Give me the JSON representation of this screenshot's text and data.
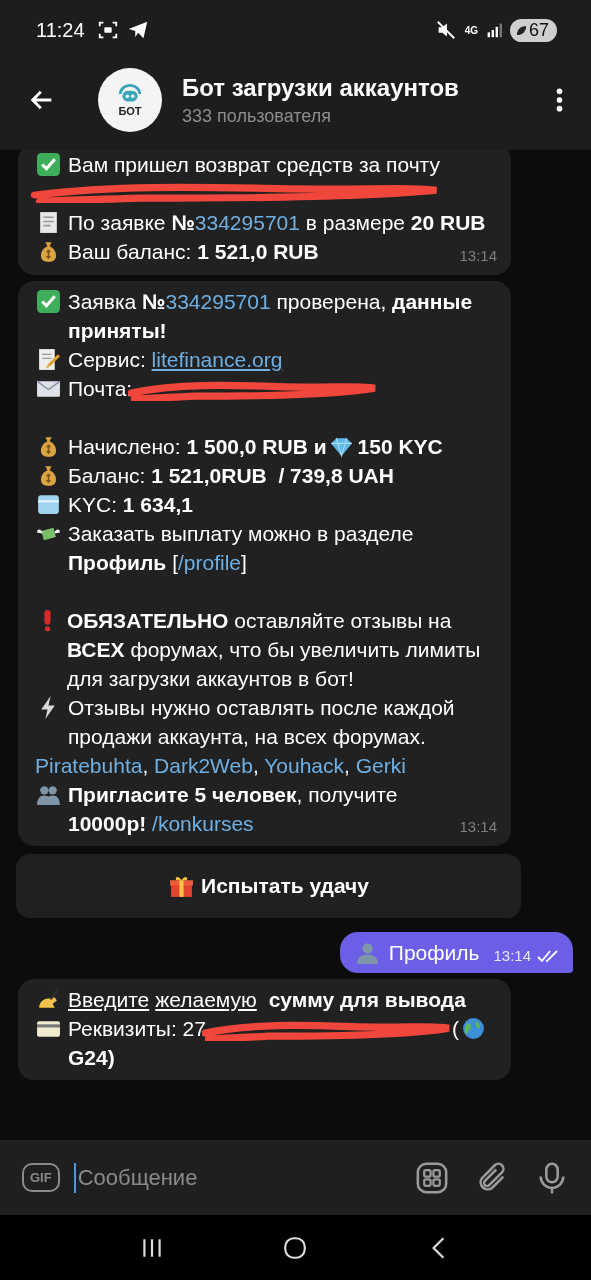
{
  "status_bar": {
    "time": "11:24",
    "network": "4G",
    "battery": "67"
  },
  "header": {
    "avatar_label": "БОТ",
    "title": "Бот загрузки аккаунтов",
    "subtitle": "333 пользователя"
  },
  "messages": [
    {
      "kind": "incoming",
      "time": "13:14",
      "lines": [
        {
          "segments": [
            {
              "kind": "icon"
            },
            {
              "kind": "text",
              "text": "Вам пришел возврат средств за почту"
            }
          ]
        },
        {
          "segments": [
            {
              "kind": "redaction"
            }
          ]
        },
        {
          "segments": [
            {
              "kind": "icon"
            },
            {
              "kind": "text",
              "text": "По заявке **№**"
            },
            {
              "kind": "link",
              "text": "334295701"
            },
            {
              "kind": "text",
              "text": " в размере **20 RUB**"
            }
          ]
        },
        {
          "segments": [
            {
              "kind": "icon"
            },
            {
              "kind": "text",
              "text": "Ваш баланс: **1 521,0 RUB**"
            }
          ]
        }
      ]
    },
    {
      "kind": "incoming",
      "time": "13:14",
      "lines": [
        {
          "segments": [
            {
              "kind": "icon"
            },
            {
              "kind": "text",
              "text": "Заявка **№**"
            },
            {
              "kind": "link",
              "text": "334295701"
            },
            {
              "kind": "text",
              "text": " проверена, **данные приняты!**"
            }
          ]
        },
        {
          "segments": [
            {
              "kind": "icon"
            },
            {
              "kind": "text",
              "text": "Сервис: "
            },
            {
              "kind": "link",
              "text": "litefinance.org",
              "underlined": true
            }
          ]
        },
        {
          "segments": [
            {
              "kind": "icon"
            },
            {
              "kind": "text",
              "text": "Почта:"
            },
            {
              "kind": "redaction"
            }
          ]
        },
        {
          "spaced": true,
          "segments": [
            {
              "kind": "icon"
            },
            {
              "kind": "text",
              "text": "Начислено: **1 500,0 RUB и**"
            },
            {
              "kind": "icon"
            },
            {
              "kind": "text",
              "text": "**150 KYC**"
            }
          ]
        },
        {
          "segments": [
            {
              "kind": "icon"
            },
            {
              "kind": "text",
              "text": "Баланс: **1 521,0RUB  / 739,8 UAH**"
            }
          ]
        },
        {
          "segments": [
            {
              "kind": "icon"
            },
            {
              "kind": "text",
              "text": "KYC: **1 634,1**"
            }
          ]
        },
        {
          "segments": [
            {
              "kind": "icon"
            },
            {
              "kind": "text",
              "text": "Заказать выплату можно в разделе **Профиль** ["
            },
            {
              "kind": "link",
              "text": "/profile"
            },
            {
              "kind": "text",
              "text": "]"
            }
          ]
        },
        {
          "spaced": true,
          "segments": [
            {
              "kind": "icon"
            },
            {
              "kind": "text",
              "text": "**ОБЯЗАТЕЛЬНО** оставляйте отзывы на **ВСЕХ** форумах, что бы увеличить лимиты для загрузки аккаунтов в бот!"
            }
          ]
        },
        {
          "segments": [
            {
              "kind": "icon"
            },
            {
              "kind": "text",
              "text": "Отзывы нужно оставлять после каждой продажи аккаунта, на всех форумах."
            }
          ]
        },
        {
          "segments": [
            {
              "kind": "link",
              "text": "Piratebuhta"
            },
            {
              "kind": "text",
              "text": ", "
            },
            {
              "kind": "link",
              "text": "Dark2Web"
            },
            {
              "kind": "text",
              "text": ", "
            },
            {
              "kind": "link",
              "text": "Youhack"
            },
            {
              "kind": "text",
              "text": ", "
            },
            {
              "kind": "link",
              "text": "Gerki"
            }
          ]
        },
        {
          "segments": [
            {
              "kind": "icon"
            },
            {
              "kind": "text",
              "text": "**Пригласите 5 человек**, получите **10000р!** "
            },
            {
              "kind": "link",
              "text": "/konkurses"
            }
          ]
        }
      ]
    },
    {
      "kind": "keyboard",
      "label": "Испытать удачу"
    },
    {
      "kind": "outgoing",
      "text": "Профиль",
      "time": "13:14",
      "read": true
    },
    {
      "kind": "incoming",
      "lines": [
        {
          "segments": [
            {
              "kind": "icon"
            },
            {
              "kind": "underlined",
              "text": "Введите"
            },
            {
              "kind": "underlined",
              "text": "желаемую"
            },
            {
              "kind": "text",
              "text": " **сумму для вывода**"
            }
          ]
        },
        {
          "segments": [
            {
              "kind": "icon"
            },
            {
              "kind": "text",
              "text": "Реквизиты: 27"
            },
            {
              "kind": "redaction"
            },
            {
              "kind": "text",
              "text": "("
            },
            {
              "kind": "icon"
            },
            {
              "kind": "text",
              "text": "**G24)**"
            }
          ]
        }
      ]
    }
  ],
  "composer": {
    "gif_label": "GIF",
    "placeholder": "Сообщение"
  }
}
